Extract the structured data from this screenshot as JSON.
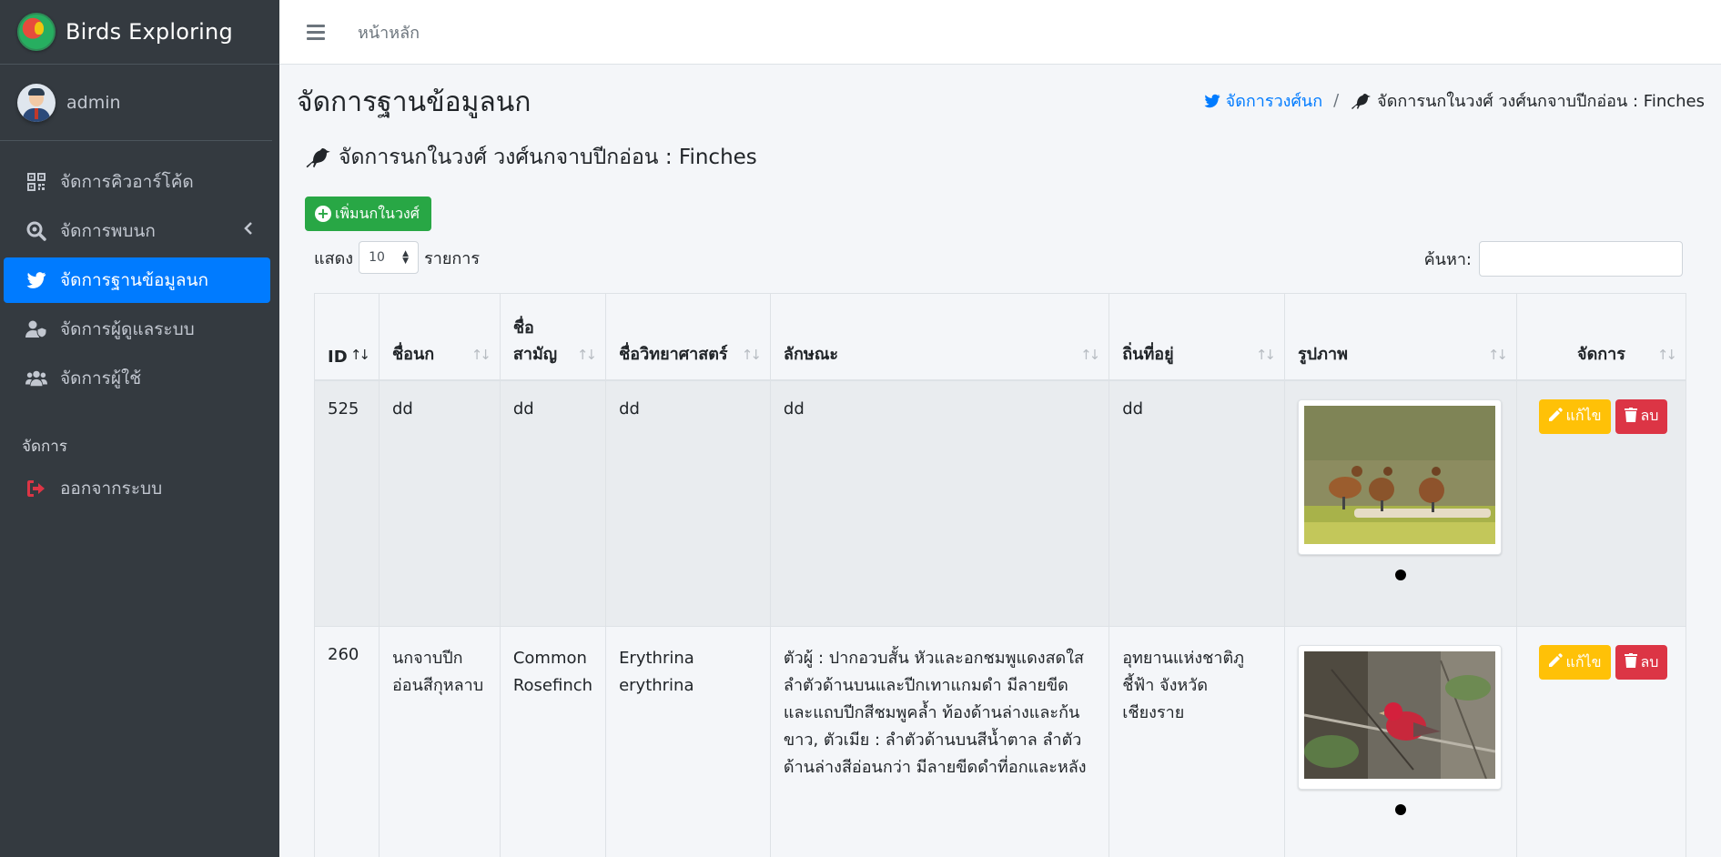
{
  "brand": {
    "name": "Birds Exploring"
  },
  "user": {
    "name": "admin"
  },
  "sidebar": {
    "items": [
      {
        "label": "จัดการคิวอาร์โค้ด",
        "icon": "qrcode-icon"
      },
      {
        "label": "จัดการพบนก",
        "icon": "search-icon"
      },
      {
        "label": "จัดการฐานข้อมูลนก",
        "icon": "twitter-bird-icon"
      },
      {
        "label": "จัดการผู้ดูแลระบบ",
        "icon": "user-shield-icon"
      },
      {
        "label": "จัดการผู้ใช้",
        "icon": "users-icon"
      }
    ],
    "header": "จัดการ",
    "logout": {
      "label": "ออกจากระบบ",
      "icon": "sign-out-icon"
    }
  },
  "topbar": {
    "home": "หน้าหลัก"
  },
  "page": {
    "title": "จัดการฐานข้อมูลนก",
    "breadcrumb": {
      "link": "จัดการวงศ์นก",
      "sep": "/",
      "current": "จัดการนกในวงศ์ วงศ์นกจาบปีกอ่อน : Finches"
    },
    "card_title": "จัดการนกในวงศ์ วงศ์นกจาบปีกอ่อน : Finches",
    "add_button": "เพิ่มนกในวงศ์",
    "length": {
      "prefix": "แสดง",
      "value": "10",
      "suffix": "รายการ"
    },
    "search": {
      "label": "ค้นหา:"
    }
  },
  "table": {
    "headers": {
      "id": "ID",
      "name": "ชื่อนก",
      "common_1": "ชื่อ",
      "common_2": "สามัญ",
      "scientific": "ชื่อวิทยาศาสตร์",
      "features": "ลักษณะ",
      "habitat": "ถิ่นที่อยู่",
      "image": "รูปภาพ",
      "manage": "จัดการ"
    },
    "edit_label": "แก้ไข",
    "delete_label": "ลบ",
    "rows": [
      {
        "id": "525",
        "name": "dd",
        "common": "dd",
        "scientific": "dd",
        "features": "dd",
        "habitat": "dd",
        "image": "whistling-ducks-photo"
      },
      {
        "id": "260",
        "name_1": "นกจาบปีก",
        "name_2": "อ่อนสีกุหลาบ",
        "common_1": "Common",
        "common_2": "Rosefinch",
        "scientific_1": "Erythrina",
        "scientific_2": "erythrina",
        "features_1": "ตัวผู้ : ปากอวบสั้น หัวและอกชมพูแดงสดใส",
        "features_2": "ลำตัวด้านบนและปีกเทาแกมดำ มีลายขีด",
        "features_3": "และแถบปีกสีชมพูคล้ำ ท้องด้านล่างและก้น",
        "features_4": "ขาว, ตัวเมีย : ลำตัวด้านบนสีน้ำตาล ลำตัว",
        "features_5": "ด้านล่างสีอ่อนกว่า มีลายขีดดำที่อกและหลัง",
        "habitat_1": "อุทยานแห่งชาติภู",
        "habitat_2": "ชี้ฟ้า จังหวัด",
        "habitat_3": "เชียงราย",
        "image": "rosefinch-photo"
      }
    ]
  }
}
